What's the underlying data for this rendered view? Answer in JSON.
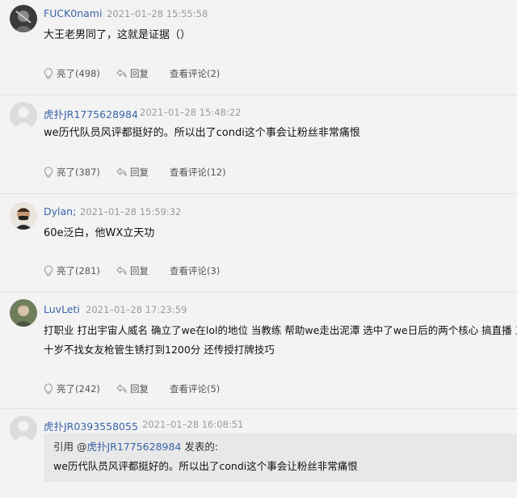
{
  "comments": [
    {
      "username": "FUCK0nami",
      "timestamp": "2021–01–28 15:55:58",
      "content": "大王老男同了，这就是证据（）",
      "like_label": "亮了(498)",
      "reply_label": "回复",
      "view_label": "查看评论(2)"
    },
    {
      "username": "虎扑JR1775628984",
      "timestamp": "2021–01–28 15:48:22",
      "content": "we历代队员风评都挺好的。所以出了condi这个事会让粉丝非常痛恨",
      "like_label": "亮了(387)",
      "reply_label": "回复",
      "view_label": "查看评论(12)"
    },
    {
      "username": "Dylan;",
      "timestamp": "2021–01–28 15:59:32",
      "content": "60e泛白，他WX立天功",
      "like_label": "亮了(281)",
      "reply_label": "回复",
      "view_label": "查看评论(3)"
    },
    {
      "username": "LuvLeti",
      "timestamp": "2021–01–28 17:23:59",
      "content_line1": "打职业 打出宇宙人威名 确立了we在lol的地位 当教练 帮助we走出泥潭 选中了we日后的两个核心 搞直播 三",
      "content_line2": "十岁不找女友枪管生锈打到1200分 还传授打牌技巧",
      "like_label": "亮了(242)",
      "reply_label": "回复",
      "view_label": "查看评论(5)"
    },
    {
      "username": "虎扑JR0393558055",
      "timestamp": "2021–01–28 16:08:51",
      "quote_prefix": "引用 @",
      "quote_user": "虎扑JR1775628984",
      "quote_suffix": " 发表的:",
      "quote_body": "we历代队员风评都挺好的。所以出了condi这个事会让粉丝非常痛恨"
    }
  ]
}
